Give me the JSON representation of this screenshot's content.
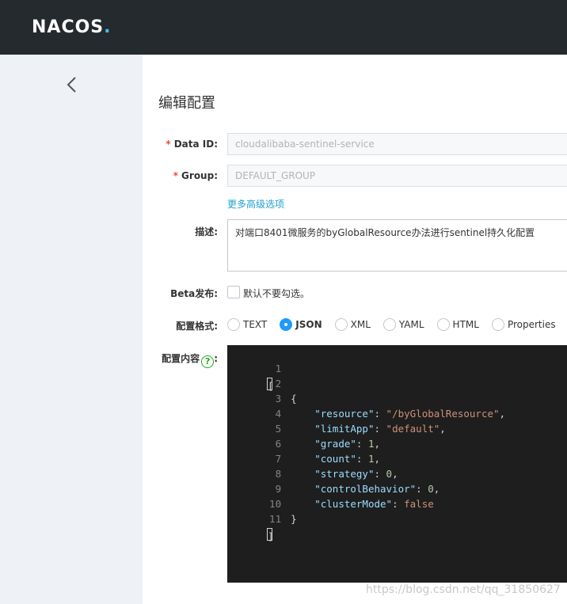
{
  "header": {
    "logo_text": "NACOS",
    "logo_dot": "."
  },
  "page": {
    "title": "编辑配置"
  },
  "form": {
    "data_id": {
      "label": "Data ID:",
      "required_mark": "*",
      "value": "cloudalibaba-sentinel-service"
    },
    "group": {
      "label": "Group:",
      "required_mark": "*",
      "value": "DEFAULT_GROUP"
    },
    "advanced_link": "更多高级选项",
    "description": {
      "label": "描述:",
      "value": "对端口8401微服务的byGlobalResource办法进行sentinel持久化配置"
    },
    "beta": {
      "label": "Beta发布:",
      "checkbox_label": "默认不要勾选。"
    },
    "format": {
      "label": "配置格式:",
      "options": [
        "TEXT",
        "JSON",
        "XML",
        "YAML",
        "HTML",
        "Properties"
      ],
      "selected": "JSON"
    },
    "content": {
      "label": "配置内容",
      "label_suffix": ":",
      "help_glyph": "?"
    }
  },
  "editor": {
    "line_numbers": [
      "1",
      "2",
      "3",
      "4",
      "5",
      "6",
      "7",
      "8",
      "9",
      "10",
      "11"
    ],
    "lines": [
      "[",
      "    {",
      "        \"resource\": \"/byGlobalResource\",",
      "        \"limitApp\": \"default\",",
      "        \"grade\": 1,",
      "        \"count\": 1,",
      "        \"strategy\": 0,",
      "        \"controlBehavior\": 0,",
      "        \"clusterMode\": false",
      "    }",
      "]"
    ]
  },
  "watermark": "https://blog.csdn.net/qq_31850627",
  "colors": {
    "topbar": "#252a2f",
    "sidebar": "#eef1f5",
    "accent": "#209bfa",
    "link": "#20a0d0",
    "required": "#e84b3c",
    "editor_bg": "#1e1e1e"
  }
}
